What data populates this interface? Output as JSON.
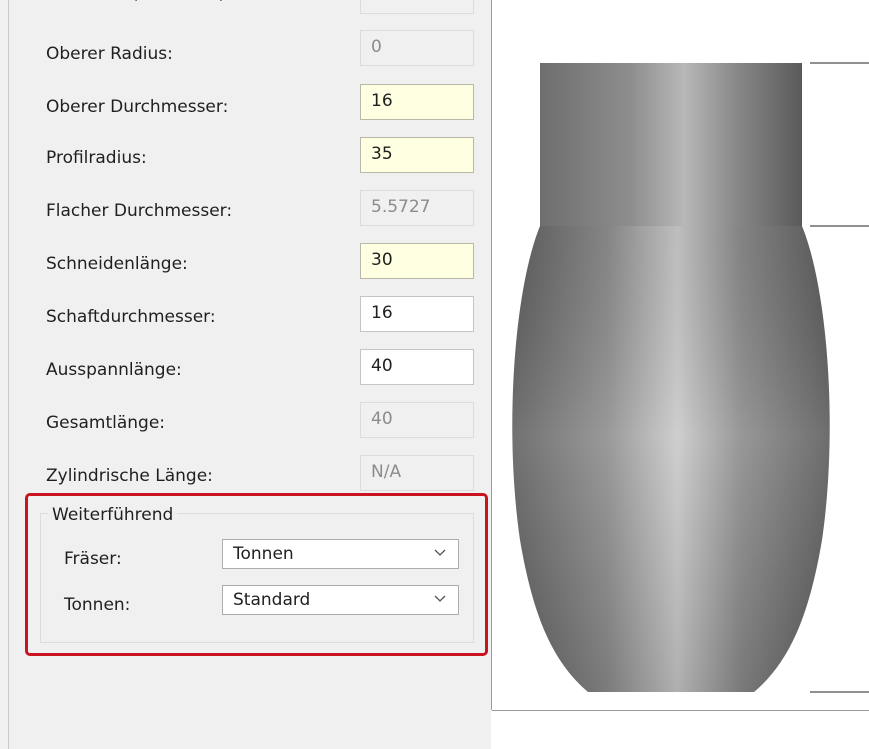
{
  "fields": [
    {
      "label": "Oberer Radius:",
      "value": "0"
    },
    {
      "label": "Oberer Durchmesser:",
      "value": "16"
    },
    {
      "label": "Profilradius:",
      "value": "35"
    },
    {
      "label": "Flacher Durchmesser:",
      "value": "5.5727"
    },
    {
      "label": "Schneidenlänge:",
      "value": "30"
    },
    {
      "label": "Schaftdurchmesser:",
      "value": "16"
    },
    {
      "label": "Ausspannlänge:",
      "value": "40"
    },
    {
      "label": "Gesamtlänge:",
      "value": "40"
    },
    {
      "label": "Zylindrische Länge:",
      "value": "N/A"
    }
  ],
  "advanced": {
    "title": "Weiterführend",
    "cutter_label": "Fräser:",
    "cutter_value": "Tonnen",
    "barrel_label": "Tonnen:",
    "barrel_value": "Standard"
  },
  "colors": {
    "required_field": "#ffffe1",
    "highlight": "#c8141e"
  },
  "icons": {
    "dropdown": "chevron-down-icon"
  }
}
